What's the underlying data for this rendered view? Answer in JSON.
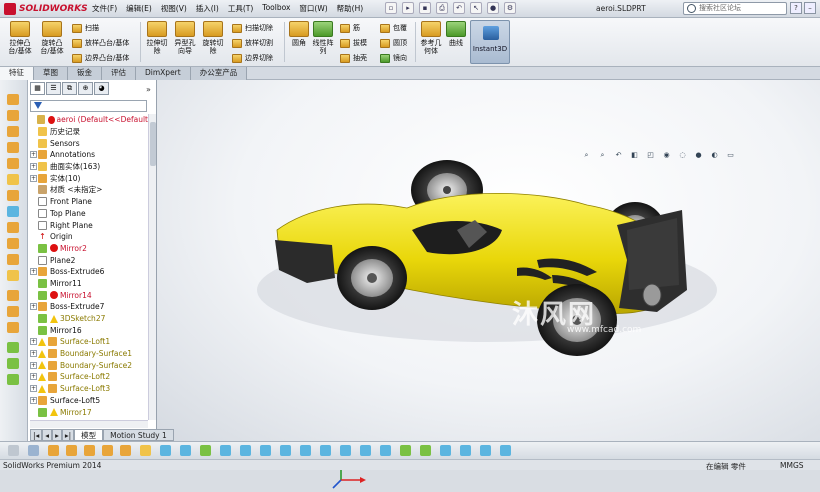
{
  "app": {
    "logo_text": "SOLIDWORKS",
    "doc_title": "aeroi.SLDPRT"
  },
  "menu": [
    "文件(F)",
    "编辑(E)",
    "视图(V)",
    "插入(I)",
    "工具(T)",
    "Toolbox",
    "窗口(W)",
    "帮助(H)"
  ],
  "search_placeholder": "搜索社区论坛",
  "ribbon": {
    "big_buttons": [
      "拉伸凸台/基体",
      "旋转凸台/基体",
      "拉伸切除",
      "异型孔向导",
      "旋转切除",
      "圆角",
      "线性阵列",
      "参考几何体",
      "曲线",
      "Instant3D"
    ],
    "small_buttons": [
      "扫描",
      "放样凸台/基体",
      "边界凸台/基体",
      "扫描切除",
      "放样切割",
      "边界切除",
      "筋",
      "拔模",
      "抽壳",
      "包覆",
      "圆顶",
      "镜向"
    ]
  },
  "tabs": [
    "特征",
    "草图",
    "钣金",
    "评估",
    "DimXpert",
    "办公室产品"
  ],
  "tree": {
    "root": "aeroi  (Default<<Default",
    "items": [
      "历史记录",
      "Sensors",
      "Annotations",
      "曲面实体(163)",
      "实体(10)",
      "材质 <未指定>",
      "Front Plane",
      "Top Plane",
      "Right Plane",
      "Origin",
      "Mirror2",
      "Plane2",
      "Boss-Extrude6",
      "Mirror11",
      "Mirror14",
      "Boss-Extrude7",
      "3DSketch27",
      "Mirror16",
      "Surface-Loft1",
      "Boundary-Surface1",
      "Boundary-Surface2",
      "Surface-Loft2",
      "Surface-Loft3",
      "Surface-Loft5",
      "Mirror17"
    ]
  },
  "watermark": {
    "main": "沐风网",
    "sub": "www.mfcad.com"
  },
  "bottom_tabs": [
    "模型",
    "Motion Study 1"
  ],
  "status": {
    "left": "SolidWorks Premium 2014",
    "middle": "在编辑 零件",
    "right": "MMGS"
  },
  "colors": {
    "car_body": "#f0e20a",
    "error": "#dd1111",
    "warning": "#f2c40f"
  }
}
